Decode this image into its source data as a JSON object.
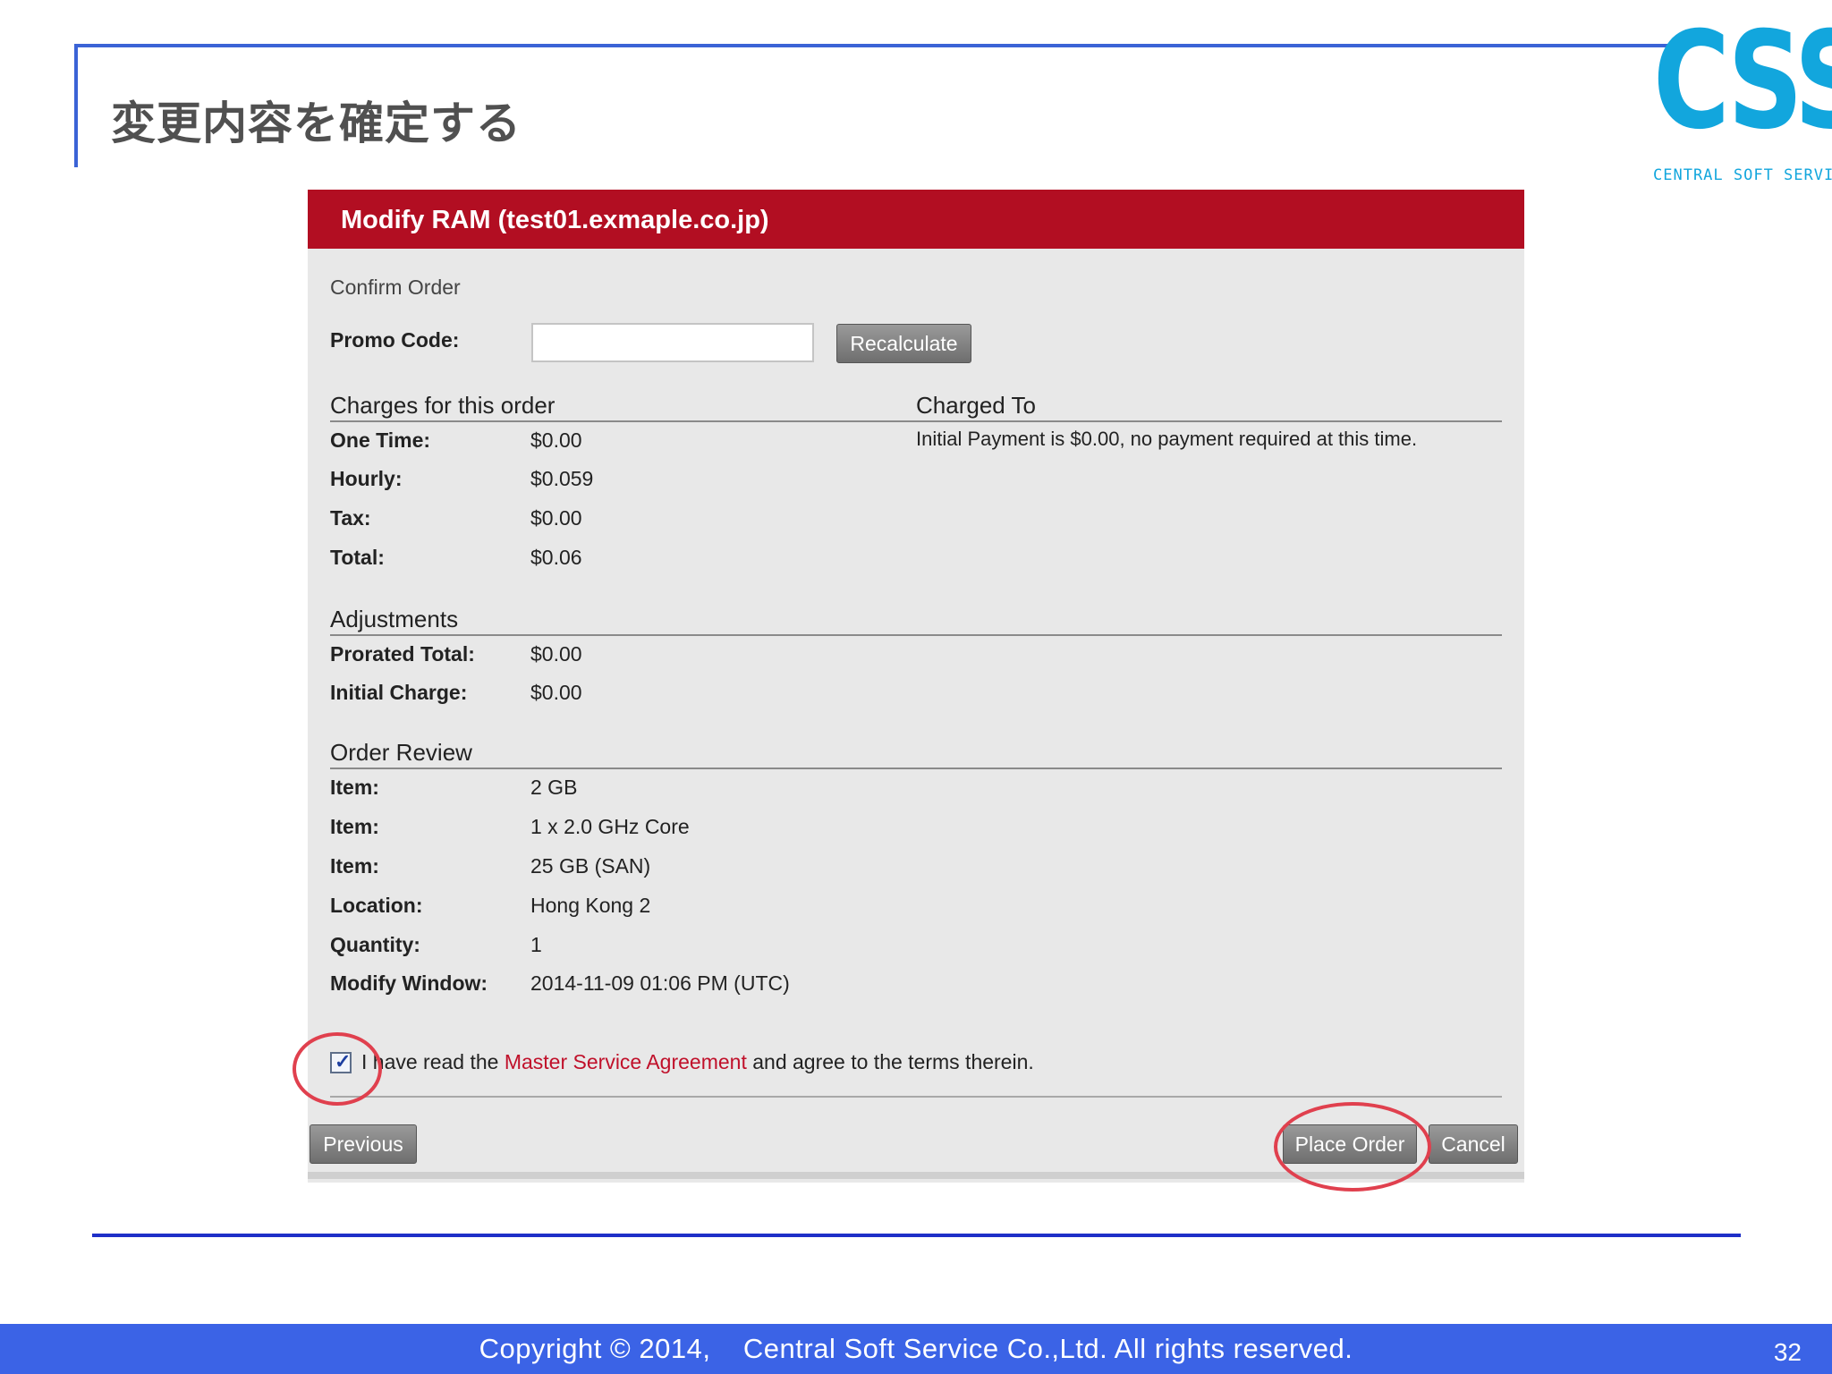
{
  "slide": {
    "title": "変更内容を確定する",
    "logo_text": "CSS",
    "logo_subtext": "CENTRAL SOFT SERVICE",
    "footer_copyright": "Copyright © 2014,    Central Soft Service Co.,Ltd. All rights reserved.",
    "page_number": "32",
    "accent_color": "#3b63e6",
    "logo_color": "#12a6dd"
  },
  "dialog": {
    "title": "Modify RAM (test01.exmaple.co.jp)",
    "header_color": "#b20e22",
    "confirm_label": "Confirm Order",
    "promo": {
      "label": "Promo Code:",
      "value": "",
      "placeholder": ""
    },
    "recalculate_label": "Recalculate",
    "charges": {
      "heading": "Charges for this order",
      "rows": [
        {
          "label": "One Time:",
          "value": "$0.00"
        },
        {
          "label": "Hourly:",
          "value": "$0.059"
        },
        {
          "label": "Tax:",
          "value": "$0.00"
        },
        {
          "label": "Total:",
          "value": "$0.06"
        }
      ]
    },
    "charged_to": {
      "heading": "Charged To",
      "note": "Initial Payment is $0.00, no payment required at this time."
    },
    "adjustments": {
      "heading": "Adjustments",
      "rows": [
        {
          "label": "Prorated Total:",
          "value": "$0.00"
        },
        {
          "label": "Initial Charge:",
          "value": "$0.00"
        }
      ]
    },
    "order_review": {
      "heading": "Order Review",
      "rows": [
        {
          "label": "Item:",
          "value": "2 GB"
        },
        {
          "label": "Item:",
          "value": "1 x 2.0 GHz Core"
        },
        {
          "label": "Item:",
          "value": "25 GB (SAN)"
        },
        {
          "label": "Location:",
          "value": "Hong Kong 2"
        },
        {
          "label": "Quantity:",
          "value": "1"
        },
        {
          "label": "Modify Window:",
          "value": "2014-11-09 01:06 PM (UTC)"
        }
      ]
    },
    "agreement": {
      "checked": true,
      "prefix": "I have read the ",
      "link": "Master Service Agreement",
      "suffix": " and agree to the terms therein."
    },
    "buttons": {
      "previous": "Previous",
      "place_order": "Place Order",
      "cancel": "Cancel"
    }
  }
}
